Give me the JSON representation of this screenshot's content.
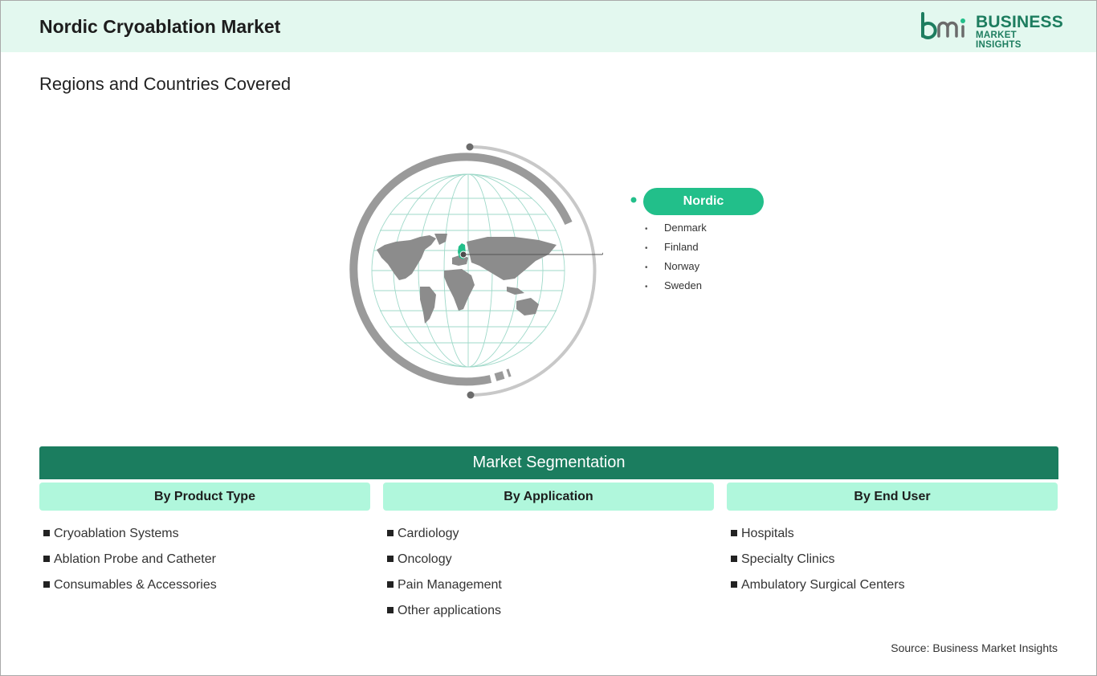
{
  "header": {
    "title": "Nordic Cryoablation Market"
  },
  "logo": {
    "line1": "BUSINESS",
    "line2": "MARKET INSIGHTS",
    "brand_color": "#1d7d5f"
  },
  "subtitle": "Regions and Countries Covered",
  "region": {
    "name": "Nordic",
    "countries": [
      "Denmark",
      "Finland",
      "Norway",
      "Sweden"
    ],
    "highlight_color": "#22bf8a"
  },
  "segmentation": {
    "title": "Market Segmentation",
    "columns": [
      {
        "heading": "By Product Type",
        "items": [
          "Cryoablation Systems",
          "Ablation Probe and Catheter",
          "Consumables & Accessories"
        ]
      },
      {
        "heading": "By Application",
        "items": [
          "Cardiology",
          "Oncology",
          "Pain Management",
          "Other applications"
        ]
      },
      {
        "heading": "By End User",
        "items": [
          "Hospitals",
          "Specialty Clinics",
          "Ambulatory Surgical Centers"
        ]
      }
    ],
    "bar_color": "#1b7d5f",
    "heading_bg": "#b0f7dc"
  },
  "source": "Source: Business Market Insights"
}
